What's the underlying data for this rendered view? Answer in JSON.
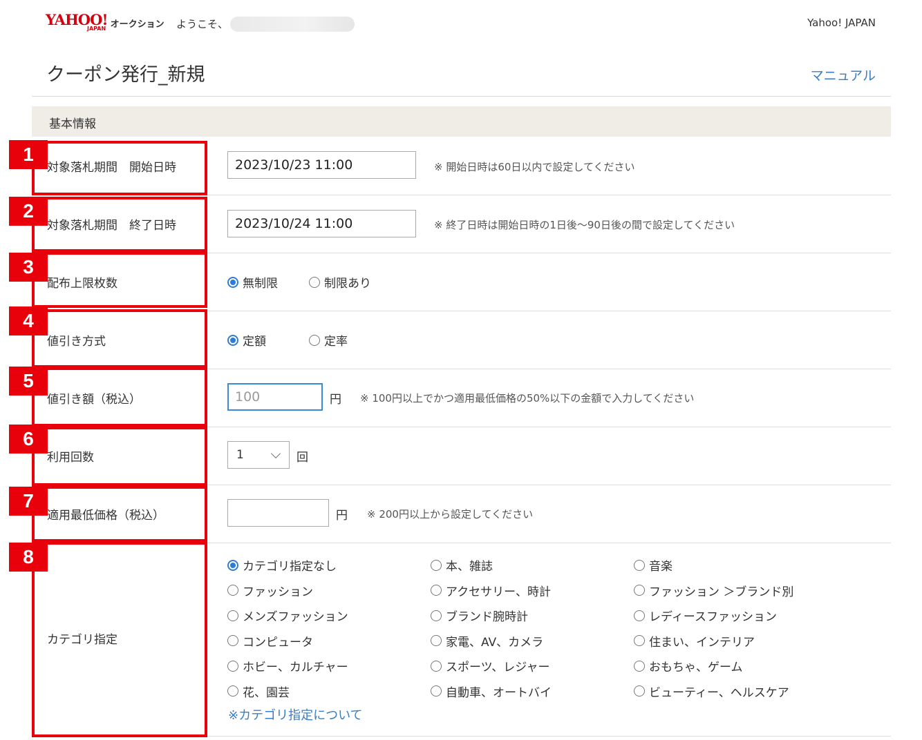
{
  "header": {
    "logo_text": "YAHOO!",
    "logo_sub": "JAPAN",
    "service": "オークション",
    "welcome": "ようこそ、",
    "top_link": "Yahoo! JAPAN"
  },
  "page": {
    "title": "クーポン発行_新規",
    "manual_link": "マニュアル"
  },
  "section": {
    "title": "基本情報"
  },
  "badges": [
    "1",
    "2",
    "3",
    "4",
    "5",
    "6",
    "7",
    "8"
  ],
  "fields": {
    "start": {
      "label": "対象落札期間　開始日時",
      "value": "2023/10/23 11:00",
      "note": "※ 開始日時は60日以内で設定してください"
    },
    "end": {
      "label": "対象落札期間　終了日時",
      "value": "2023/10/24 11:00",
      "note": "※ 終了日時は開始日時の1日後～90日後の間で設定してください"
    },
    "limit": {
      "label": "配布上限枚数",
      "options": [
        "無制限",
        "制限あり"
      ],
      "selected": "無制限"
    },
    "method": {
      "label": "値引き方式",
      "options": [
        "定額",
        "定率"
      ],
      "selected": "定額"
    },
    "discount": {
      "label": "値引き額（税込）",
      "placeholder": "100",
      "unit": "円",
      "note": "※ 100円以上でかつ適用最低価格の50%以下の金額で入力してください"
    },
    "uses": {
      "label": "利用回数",
      "value": "1",
      "unit": "回"
    },
    "min_price": {
      "label": "適用最低価格（税込）",
      "value": "",
      "unit": "円",
      "note": "※ 200円以上から設定してください"
    },
    "category": {
      "label": "カテゴリ指定",
      "selected": "カテゴリ指定なし",
      "options": [
        "カテゴリ指定なし",
        "本、雑誌",
        "音楽",
        "ファッション",
        "アクセサリー、時計",
        "ファッション ＞ブランド別",
        "メンズファッション",
        "ブランド腕時計",
        "レディースファッション",
        "コンピュータ",
        "家電、AV、カメラ",
        "住まい、インテリア",
        "ホビー、カルチャー",
        "スポーツ、レジャー",
        "おもちゃ、ゲーム",
        "花、園芸",
        "自動車、オートバイ",
        "ビューティー、ヘルスケア"
      ],
      "help_link": "※カテゴリ指定について"
    }
  },
  "colors": {
    "accent": "#2e7cd6",
    "highlight": "#e8000b",
    "brand": "#d7000f",
    "section_bg": "#efede6"
  }
}
